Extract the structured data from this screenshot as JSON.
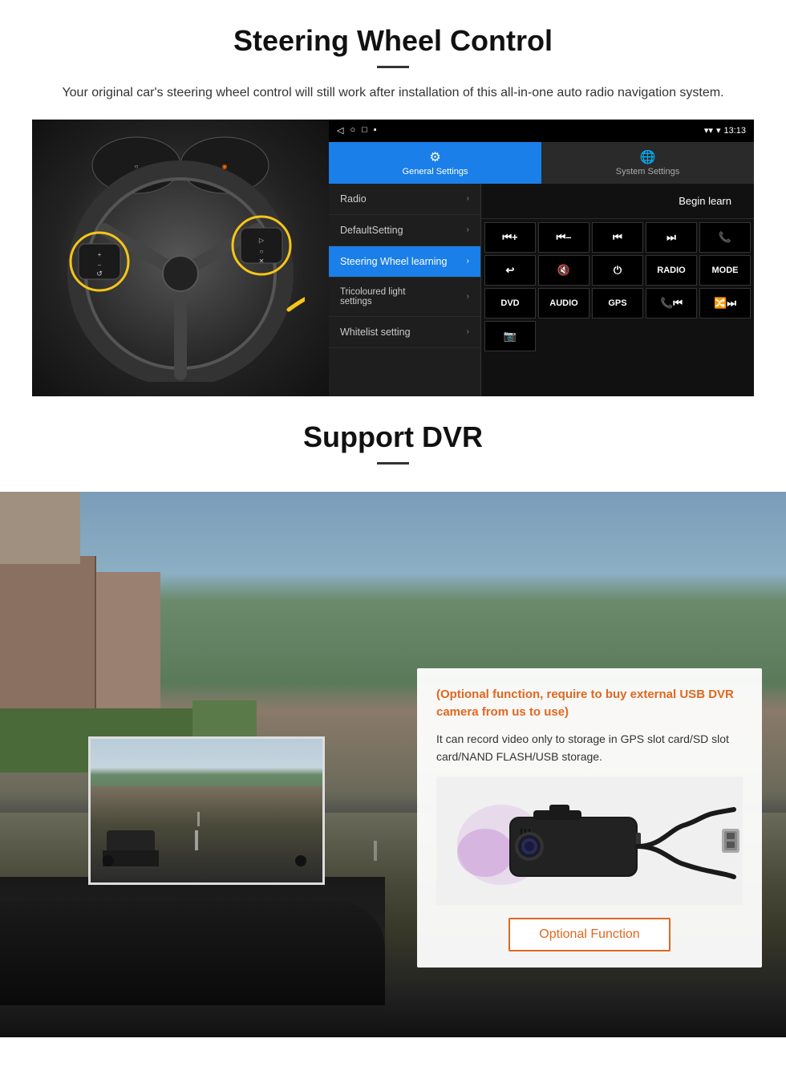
{
  "section1": {
    "title": "Steering Wheel Control",
    "description": "Your original car's steering wheel control will still work after installation of this all-in-one auto radio navigation system.",
    "android": {
      "statusbar": {
        "time": "13:13",
        "signal_icon": "▼",
        "wifi_icon": "▾"
      },
      "navbar_icons": [
        "◁",
        "○",
        "□",
        "⬛"
      ],
      "tab_general": "General Settings",
      "tab_system": "System Settings",
      "tab_general_icon": "⚙",
      "tab_system_icon": "🌐",
      "menu_items": [
        {
          "label": "Radio",
          "active": false
        },
        {
          "label": "DefaultSetting",
          "active": false
        },
        {
          "label": "Steering Wheel learning",
          "active": true
        },
        {
          "label": "Tricoloured light settings",
          "active": false
        },
        {
          "label": "Whitelist setting",
          "active": false
        }
      ],
      "begin_learn": "Begin learn",
      "controls": [
        "⏮+",
        "⏮–",
        "⏮",
        "⏭",
        "☏",
        "↩",
        "🔇",
        "⏻",
        "RADIO",
        "MODE",
        "DVD",
        "AUDIO",
        "GPS",
        "📞⏮",
        "🔀⏭",
        "📷"
      ]
    }
  },
  "section2": {
    "title": "Support DVR",
    "optional_text": "(Optional function, require to buy external USB DVR camera from us to use)",
    "description": "It can record video only to storage in GPS slot card/SD slot card/NAND FLASH/USB storage.",
    "optional_button": "Optional Function"
  }
}
